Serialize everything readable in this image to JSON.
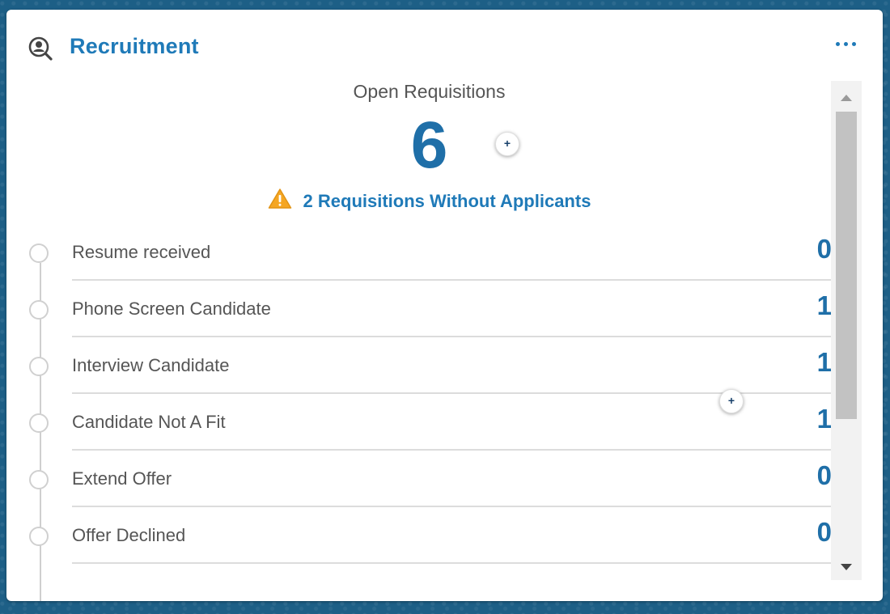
{
  "widget": {
    "title": "Recruitment",
    "header_icon": "user-search-icon",
    "more_icon": "more-dots-icon"
  },
  "summary": {
    "label": "Open Requisitions",
    "count": "6",
    "add_symbol": "+"
  },
  "warning": {
    "icon": "warning-triangle-icon",
    "text": "2 Requisitions Without Applicants"
  },
  "stages": [
    {
      "label": "Resume received",
      "count": "0"
    },
    {
      "label": "Phone Screen Candidate",
      "count": "1"
    },
    {
      "label": "Interview Candidate",
      "count": "1"
    },
    {
      "label": "Candidate Not A Fit",
      "count": "1"
    },
    {
      "label": "Extend Offer",
      "count": "0"
    },
    {
      "label": "Offer Declined",
      "count": "0"
    }
  ],
  "floating_add": {
    "symbol": "+"
  },
  "colors": {
    "accent": "#1f7ab8",
    "count": "#1f6fa8",
    "warning": "#f5a623",
    "background": "#1d5f86"
  }
}
